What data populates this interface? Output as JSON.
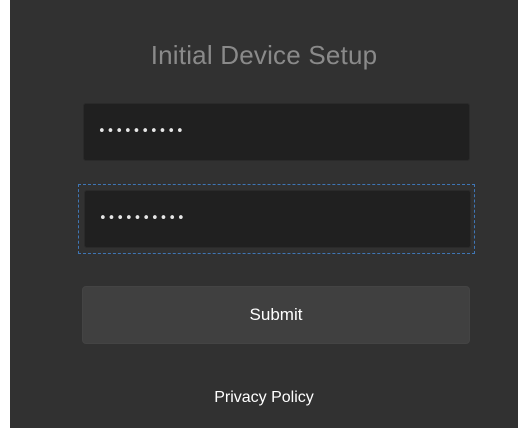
{
  "setup": {
    "title": "Initial Device Setup",
    "password_value": "••••••••••",
    "confirm_password_value": "••••••••••",
    "submit_label": "Submit",
    "privacy_link": "Privacy Policy"
  },
  "colors": {
    "panel_background": "#313131",
    "input_background": "#202020",
    "button_background": "#404040",
    "title_text": "#8a8a8a",
    "focus_outline": "#3f76b5"
  }
}
